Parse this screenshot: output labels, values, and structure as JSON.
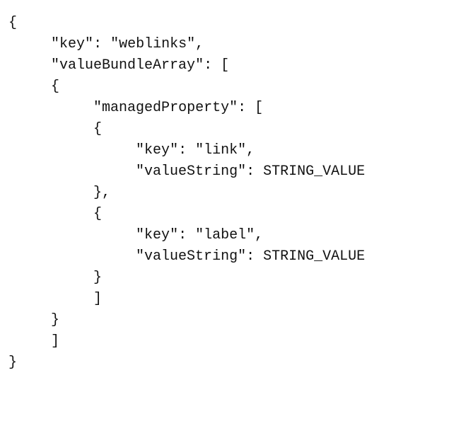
{
  "code": {
    "indent1": "     ",
    "indent2": "          ",
    "indent3": "               ",
    "dq": "\"",
    "brace_open": "{",
    "brace_close": "}",
    "bracket_open": "[",
    "bracket_close": "]",
    "colon_space": ": ",
    "comma": ",",
    "k_key": "key",
    "k_valueBundleArray": "valueBundleArray",
    "k_managedProperty": "managedProperty",
    "k_valueString": "valueString",
    "v_weblinks": "weblinks",
    "v_link": "link",
    "v_label": "label",
    "v_string_value": "STRING_VALUE"
  }
}
